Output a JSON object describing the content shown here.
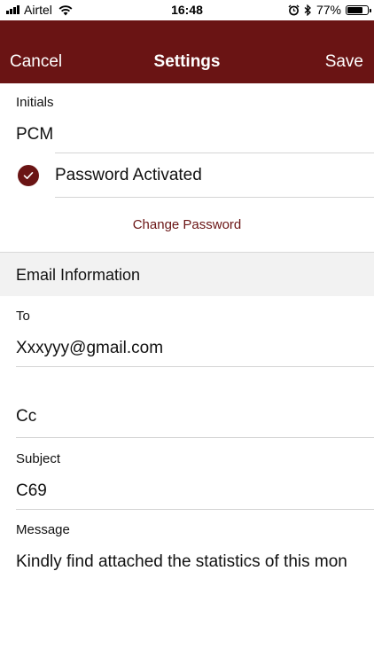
{
  "status_bar": {
    "carrier": "Airtel",
    "time": "16:48",
    "battery_percent": "77%",
    "battery_level": 0.77,
    "icons": [
      "signal-icon",
      "wifi-icon",
      "alarm-icon",
      "bluetooth-icon",
      "battery-icon"
    ]
  },
  "navbar": {
    "cancel_label": "Cancel",
    "title": "Settings",
    "save_label": "Save",
    "background": "#6a1414"
  },
  "initials": {
    "label": "Initials",
    "value": "PCM"
  },
  "password": {
    "label": "Password Activated",
    "activated": true,
    "change_label": "Change Password"
  },
  "email_section": {
    "header": "Email Information",
    "to_label": "To",
    "to_value": "Xxxyyy@gmail.com",
    "cc_label": "Cc",
    "subject_label": "Subject",
    "subject_value": "C69",
    "message_label": "Message",
    "message_value": "Kindly find attached the statistics of this mon"
  }
}
